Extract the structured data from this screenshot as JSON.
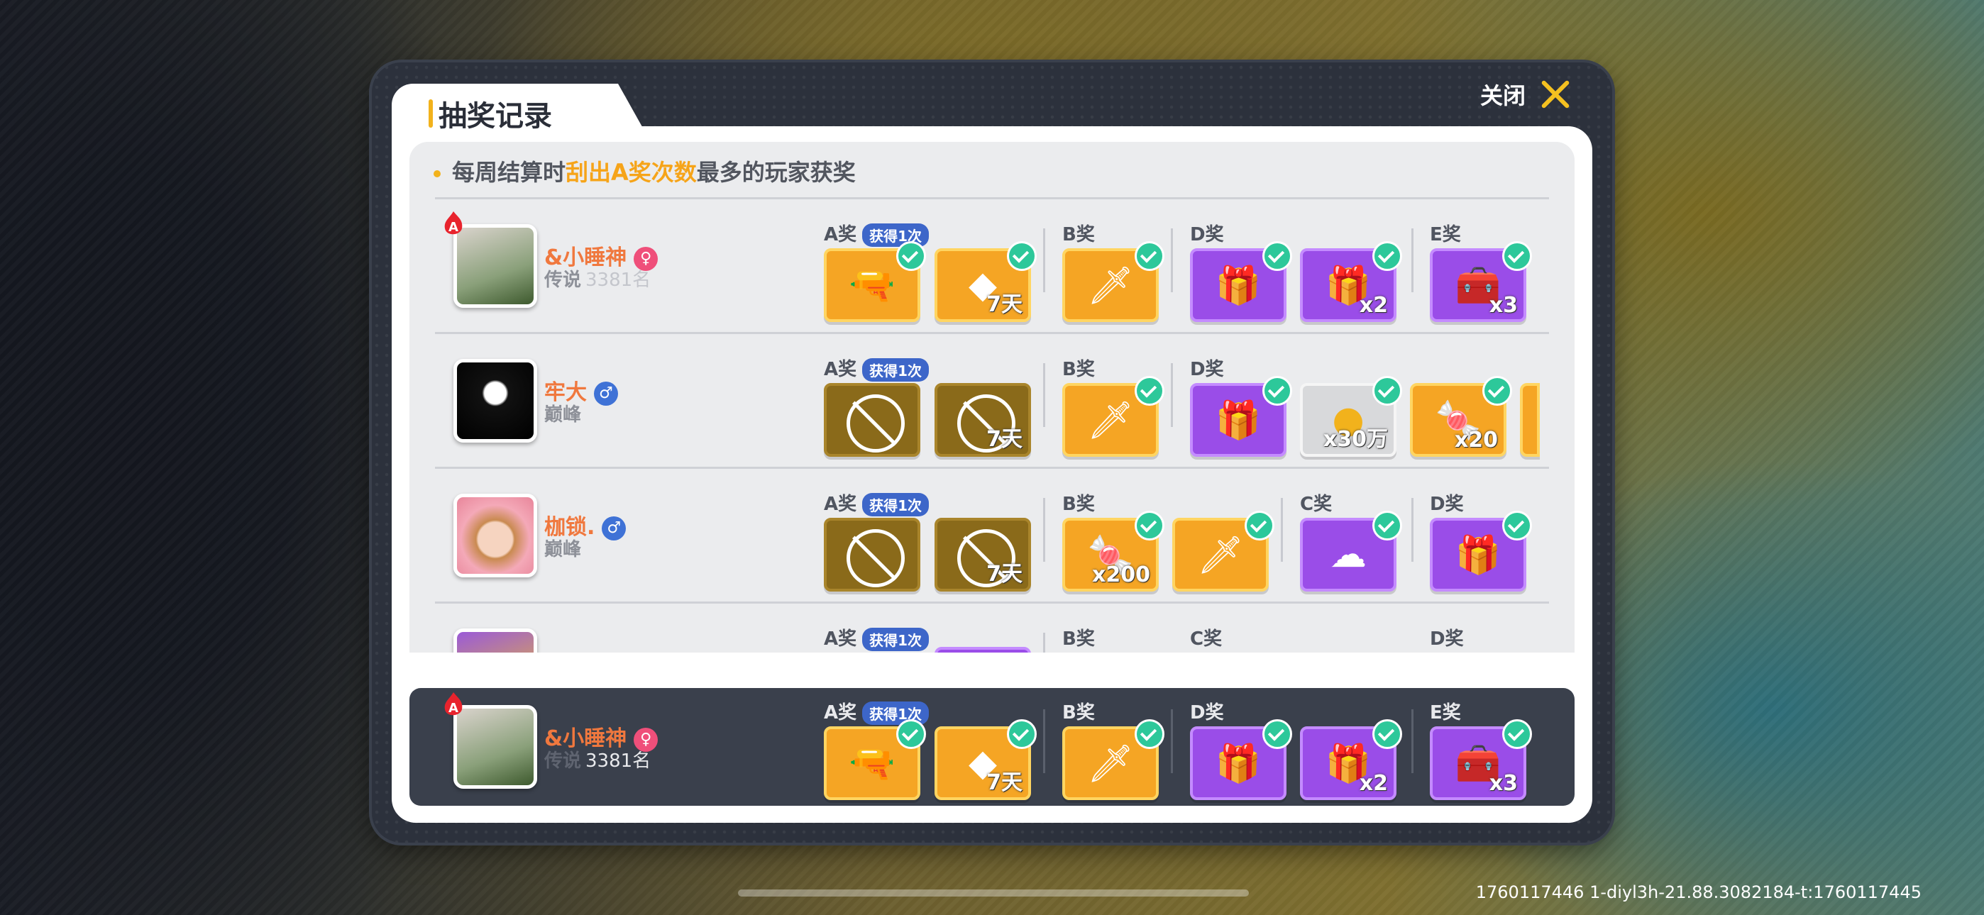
{
  "dialog": {
    "title": "抽奖记录",
    "close_label": "关闭"
  },
  "notice": {
    "prefix": "每周结算时",
    "highlight": "刮出A奖次数",
    "suffix": "最多的玩家获奖"
  },
  "got_tag": "获得1次",
  "labels": {
    "A": "A奖",
    "B": "B奖",
    "C": "C奖",
    "D": "D奖",
    "E": "E奖"
  },
  "rows": [
    {
      "name": "&小睡神",
      "gender": "♀",
      "rank": "传说",
      "rank_sub": "3381名",
      "items": {
        "a1": "",
        "a2": "7天",
        "b1": "",
        "d1": "",
        "d2": "x2",
        "e1": "x3"
      }
    },
    {
      "name": "牢大",
      "gender": "♂",
      "rank": "巅峰",
      "rank_sub": "",
      "items": {
        "a2": "7天",
        "b1": "",
        "d1": "",
        "d2": "x30万",
        "d3": "x20"
      }
    },
    {
      "name": "枷锁.",
      "gender": "♂",
      "rank": "巅峰",
      "rank_sub": "",
      "items": {
        "a2": "7天",
        "b1": "x200",
        "b2": "",
        "c1": "",
        "d1": ""
      }
    },
    {
      "name": "",
      "gender": "",
      "rank": "",
      "rank_sub": ""
    }
  ],
  "me": {
    "name": "&小睡神",
    "gender": "♀",
    "rank": "传说",
    "rank_sub": "3381名",
    "items": {
      "a2": "7天",
      "d2": "x2",
      "e1": "x3"
    }
  },
  "watermark": "1760117446  1-diyl3h-21.88.3082184-t:1760117445"
}
